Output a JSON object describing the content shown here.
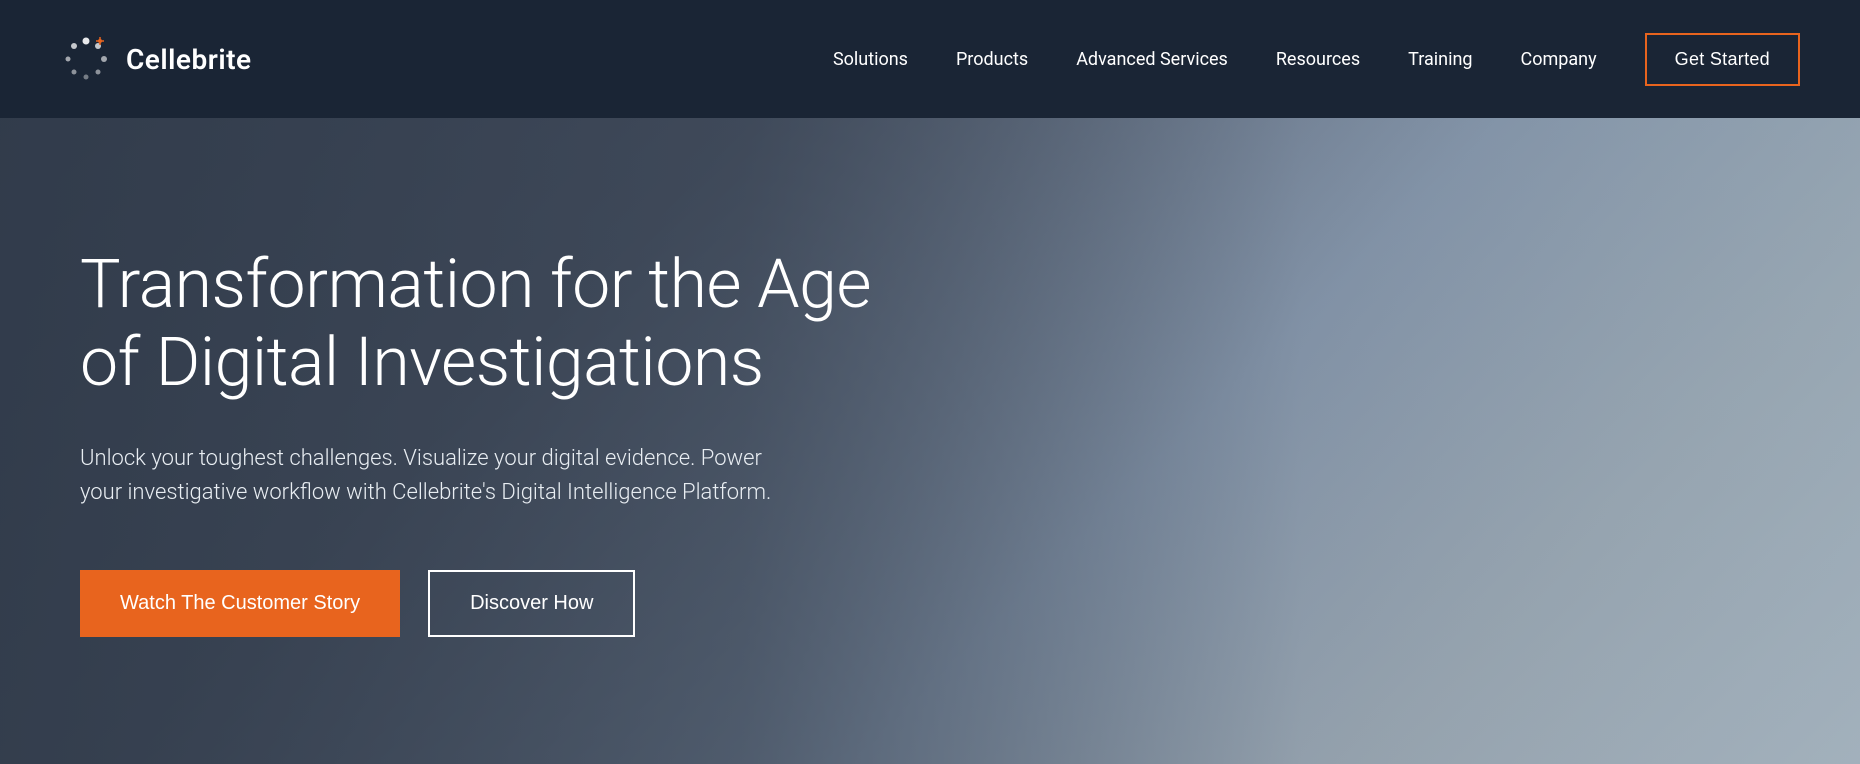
{
  "brand": {
    "name": "Cellebrite",
    "logo_alt": "Cellebrite logo"
  },
  "nav": {
    "links": [
      {
        "label": "Solutions",
        "id": "solutions"
      },
      {
        "label": "Products",
        "id": "products"
      },
      {
        "label": "Advanced Services",
        "id": "advanced-services"
      },
      {
        "label": "Resources",
        "id": "resources"
      },
      {
        "label": "Training",
        "id": "training"
      },
      {
        "label": "Company",
        "id": "company"
      }
    ],
    "cta_label": "Get Started"
  },
  "hero": {
    "title": "Transformation for the Age of Digital Investigations",
    "subtitle": "Unlock your toughest challenges. Visualize your digital evidence. Power your investigative workflow with Cellebrite's Digital Intelligence Platform.",
    "btn_primary": "Watch The Customer Story",
    "btn_secondary": "Discover How"
  },
  "colors": {
    "nav_bg": "#1a2535",
    "orange": "#e8641e",
    "white": "#ffffff"
  }
}
